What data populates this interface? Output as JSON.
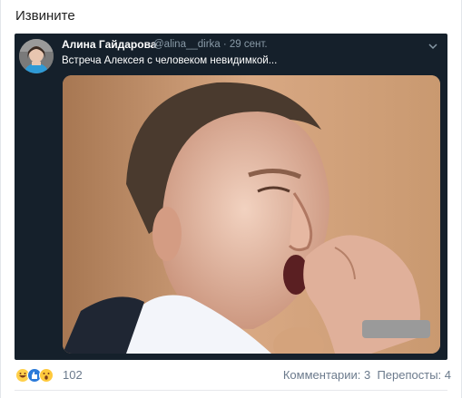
{
  "post": {
    "text": "Извините"
  },
  "tweet": {
    "author_name": "Алина Гайдарова",
    "author_handle": "@alina__dirka · 29 сент.",
    "text": "Встреча Алексея с человеком невидимкой...",
    "menu_icon": "chevron-down-icon",
    "card_bg": "#15202b"
  },
  "reactions": {
    "icons": [
      "laugh-reaction-icon",
      "like-reaction-icon",
      "wow-reaction-icon"
    ],
    "count": "102"
  },
  "stats": {
    "comments": "Комментарии: 3",
    "shares": "Перепосты: 4"
  }
}
